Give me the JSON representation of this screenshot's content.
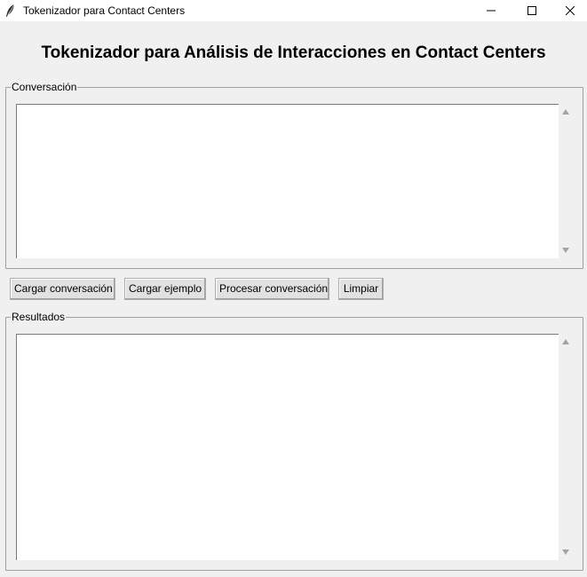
{
  "window": {
    "title": "Tokenizador para Contact Centers",
    "icon": "feather-icon",
    "controls": [
      "minimize-icon",
      "maximize-icon",
      "close-icon"
    ]
  },
  "heading": "Tokenizador para Análisis de Interacciones en Contact Centers",
  "conversation": {
    "label": "Conversación",
    "text": ""
  },
  "buttons": {
    "load": "Cargar conversación",
    "example": "Cargar ejemplo",
    "process": "Procesar conversación",
    "clear": "Limpiar"
  },
  "results": {
    "label": "Resultados",
    "text": ""
  },
  "colors": {
    "window_bg": "#f0f0f0",
    "titlebar_bg": "#ffffff",
    "text_area_bg": "#ffffff",
    "button_bg": "#e1e1e1",
    "button_border": "#adadad"
  }
}
